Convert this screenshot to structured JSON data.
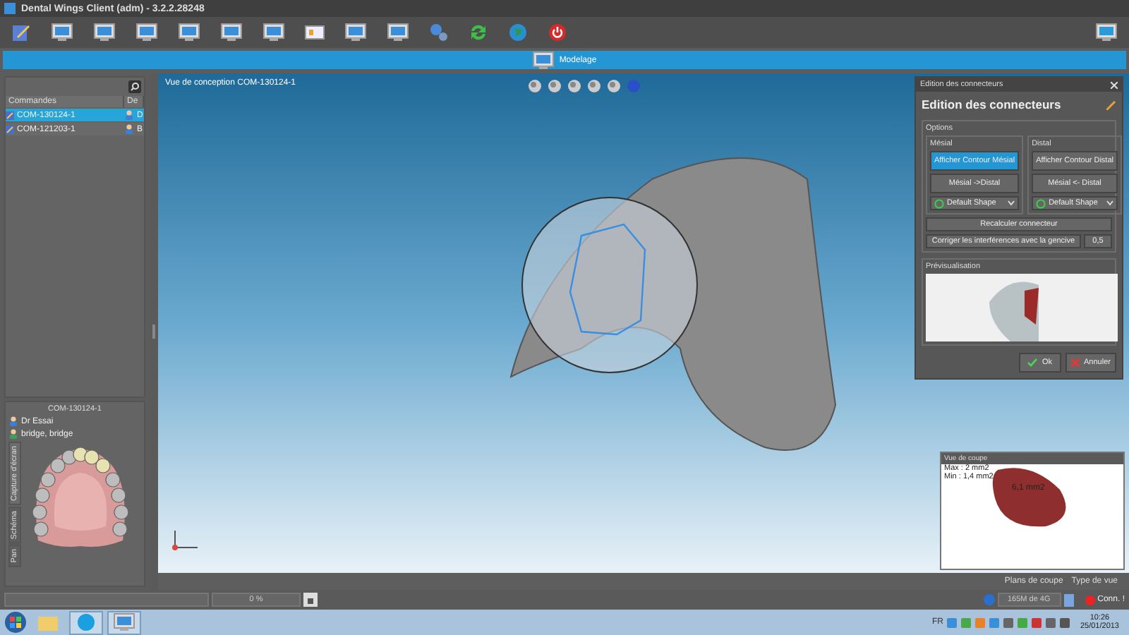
{
  "window": {
    "title": "Dental Wings Client (adm) - 3.2.2.28248"
  },
  "module_bar": {
    "label": "Modelage"
  },
  "orders": {
    "columns": [
      "Commandes",
      "De"
    ],
    "rows": [
      {
        "order": "COM-130124-1",
        "column_2": "D",
        "selected": true
      },
      {
        "order": "COM-121203-1",
        "column_2": "B",
        "selected": false
      }
    ]
  },
  "details": {
    "order": "COM-130124-1",
    "doctor": "Dr Essai",
    "work": "bridge, bridge",
    "tabs": [
      {
        "label": "Capture d'écran",
        "selected": true
      },
      {
        "label": "Schéma",
        "selected": false
      },
      {
        "label": "Pan",
        "selected": false
      }
    ]
  },
  "viewport": {
    "title": "Vue de conception",
    "order": "COM-130124-1",
    "footer": [
      "Plans de coupe",
      "Type de vue"
    ]
  },
  "dialog": {
    "window_title": "Edition des connecteurs",
    "title": "Edition des connecteurs",
    "group": "Options",
    "sides": [
      {
        "label": "Mésial",
        "show": "Afficher Contour Mésial",
        "show_selected": true,
        "direction": "Mésial ->Distal",
        "shape": "Default Shape"
      },
      {
        "label": "Distal",
        "show": "Afficher Contour Distal",
        "show_selected": false,
        "direction": "Mésial <- Distal",
        "shape": "Default Shape"
      }
    ],
    "recalc": "Recalculer connecteur",
    "correct": "Corriger les interférences avec la gencive",
    "correct_value": "0,5",
    "preview": "Prévisualisation",
    "ok": "Ok",
    "cancel": "Annuler"
  },
  "section": {
    "title": "Vue de coupe",
    "max": "Max : 2 mm2",
    "min": "Min : 1,4 mm2",
    "area": "6,1 mm2"
  },
  "status": {
    "progress": "0 %",
    "memory": "165M de 4G",
    "connection": "Conn. !"
  },
  "taskbar": {
    "language": "FR",
    "time": "10:26",
    "date": "25/01/2013"
  }
}
